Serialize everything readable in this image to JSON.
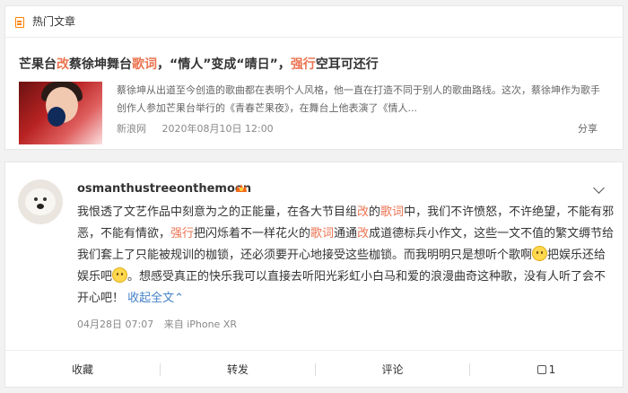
{
  "hot_articles": {
    "header_title": "热门文章",
    "article": {
      "title_segments": [
        "芒果台",
        "改",
        "蔡徐坤舞台",
        "歌词",
        "，“情人”变成“晴日”，",
        "强行",
        "空耳可还行"
      ],
      "description": "蔡徐坤从出道至今创造的歌曲都在表明个人风格，他一直在打造不同于别人的歌曲路线。这次，蔡徐坤作为歌手创作人参加芒果台举行的《青春芒果夜》，在舞台上他表演了《情人...",
      "source": "新浪网",
      "datetime": "2020年08月10日 12:00",
      "share_label": "分享"
    }
  },
  "post": {
    "username": "osmanthustreeonthemoon",
    "text_segments": {
      "s1": "我恨透了文艺作品中刻意为之的正能量，在各大节目组",
      "s2": "改",
      "s3": "的",
      "s4": "歌词",
      "s5": "中，我们不许愤怒，不许绝望，不能有邪恶，不能有情欲，",
      "s6": "强行",
      "s7": "把闪烁着不一样花火的",
      "s8": "歌词",
      "s9": "通通",
      "s10": "改",
      "s11": "成道德标兵小作文，这些一文不值的繁文缛节给我们套上了只能被规训的枷锁，还必须要开心地接受这些枷锁。而我明明只是想听个歌啊",
      "s12": "把娱乐还给娱乐吧",
      "s13": "。想感受真正的快乐我可以直接去听阳光彩虹小白马和爱的浪漫曲奇这种歌，没有人听了会不开心吧！",
      "collapse": "收起全文",
      "collapse_arrow": "⌃"
    },
    "date": "04月28日 07:07",
    "device": "来自 iPhone XR",
    "actions": {
      "favorite": "收藏",
      "repost": "转发",
      "comment": "评论",
      "like_count": "1"
    }
  },
  "colors": {
    "highlight": "#eb7350",
    "link": "#4582c7",
    "icon_orange": "#ff8200"
  }
}
